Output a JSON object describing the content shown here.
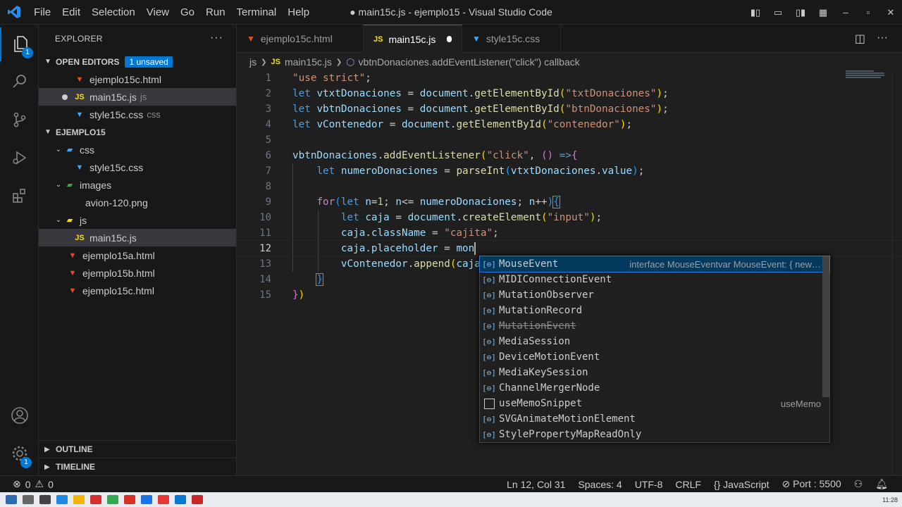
{
  "window": {
    "title": "● main15c.js - ejemplo15 - Visual Studio Code",
    "menu": [
      "File",
      "Edit",
      "Selection",
      "View",
      "Go",
      "Run",
      "Terminal",
      "Help"
    ]
  },
  "activity_bar": {
    "explorer_badge": "1",
    "settings_badge": "1"
  },
  "explorer": {
    "title": "EXPLORER",
    "open_editors_label": "OPEN EDITORS",
    "unsaved_badge": "1 unsaved",
    "open_editors": [
      {
        "name": "ejemplo15c.html",
        "hint": "",
        "type": "html"
      },
      {
        "name": "main15c.js",
        "hint": "js",
        "type": "js"
      },
      {
        "name": "style15c.css",
        "hint": "css",
        "type": "css"
      }
    ],
    "workspace_label": "EJEMPLO15",
    "tree": {
      "css_folder": "css",
      "css_file": "style15c.css",
      "images_folder": "images",
      "images_file": "avion-120.png",
      "js_folder": "js",
      "js_file": "main15c.js",
      "html_a": "ejemplo15a.html",
      "html_b": "ejemplo15b.html",
      "html_c": "ejemplo15c.html"
    },
    "outline_label": "OUTLINE",
    "timeline_label": "TIMELINE"
  },
  "tabs": [
    {
      "label": "ejemplo15c.html",
      "type": "html"
    },
    {
      "label": "main15c.js",
      "type": "js"
    },
    {
      "label": "style15c.css",
      "type": "css"
    }
  ],
  "breadcrumb": {
    "folder": "js",
    "file": "main15c.js",
    "symbol": "vbtnDonaciones.addEventListener(\"click\") callback"
  },
  "editor": {
    "line_numbers": [
      "1",
      "2",
      "3",
      "4",
      "5",
      "6",
      "7",
      "8",
      "9",
      "10",
      "11",
      "12",
      "13",
      "14",
      "15"
    ],
    "current_line": "12"
  },
  "suggest": {
    "items": [
      {
        "label": "MouseEvent",
        "detail": "interface MouseEventvar MouseEvent: { new…"
      },
      {
        "label": "MIDIConnectionEvent",
        "detail": ""
      },
      {
        "label": "MutationObserver",
        "detail": ""
      },
      {
        "label": "MutationRecord",
        "detail": ""
      },
      {
        "label": "MutationEvent",
        "detail": ""
      },
      {
        "label": "MediaSession",
        "detail": ""
      },
      {
        "label": "DeviceMotionEvent",
        "detail": ""
      },
      {
        "label": "MediaKeySession",
        "detail": ""
      },
      {
        "label": "ChannelMergerNode",
        "detail": ""
      },
      {
        "label": "useMemoSnippet",
        "detail": "useMemo"
      },
      {
        "label": "SVGAnimateMotionElement",
        "detail": ""
      },
      {
        "label": "StylePropertyMapReadOnly",
        "detail": ""
      }
    ]
  },
  "statusbar": {
    "errors": "0",
    "warnings": "0",
    "position": "Ln 12, Col 31",
    "spaces": "Spaces: 4",
    "encoding": "UTF-8",
    "eol": "CRLF",
    "language": "JavaScript",
    "port": "Port : 5500"
  },
  "taskbar": {
    "clock": "11:28"
  },
  "colors": {
    "accent": "#0078d4",
    "background": "#1f1f1f",
    "sidebar": "#181818"
  }
}
